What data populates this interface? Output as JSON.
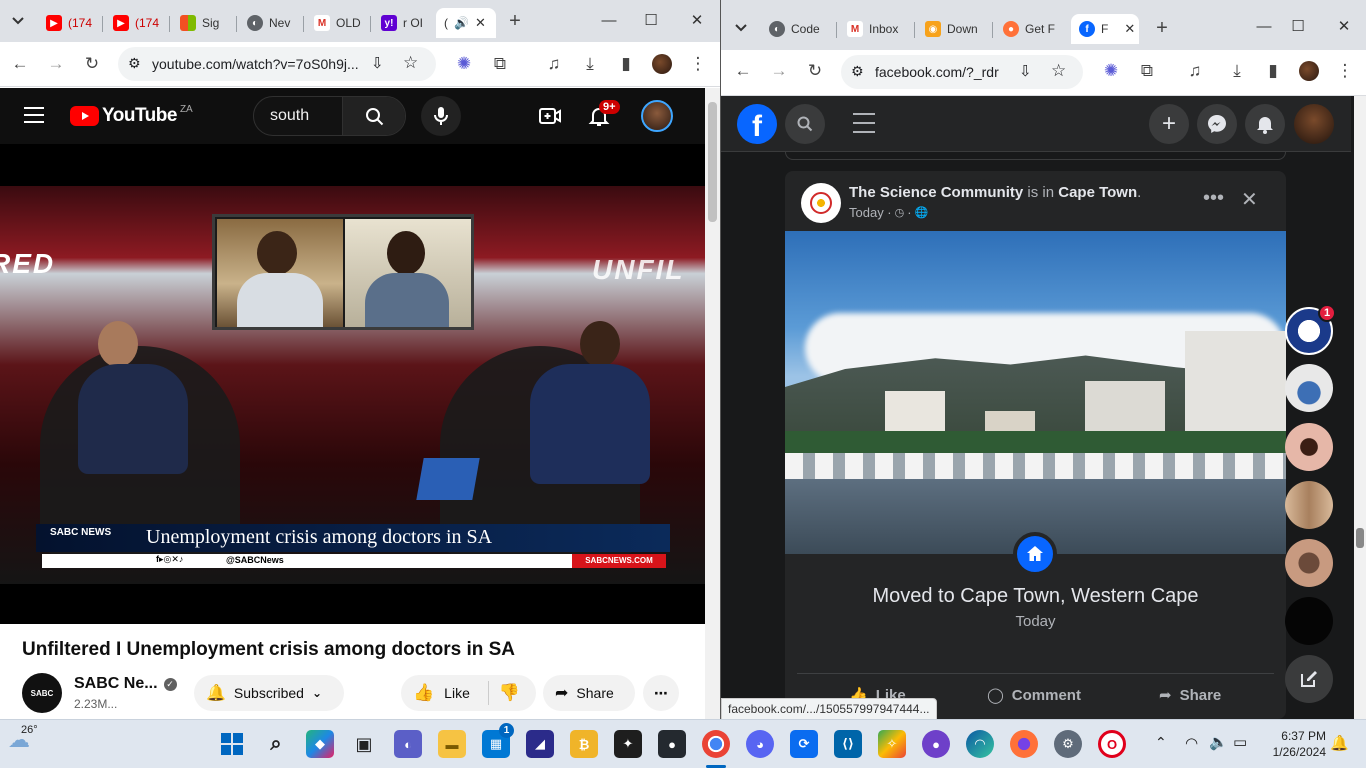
{
  "left_window": {
    "tabs": [
      {
        "label": "(174"
      },
      {
        "label": "(174"
      },
      {
        "label": "Sig"
      },
      {
        "label": "Nev"
      },
      {
        "label": "OLD"
      },
      {
        "label": "r OI"
      },
      {
        "label": "("
      }
    ],
    "url": "youtube.com/watch?v=7oS0h9j...",
    "youtube": {
      "logo_text": "YouTube",
      "region": "ZA",
      "search_value": "south",
      "notification_count": "9+",
      "video_title": "Unfiltered I Unemployment crisis among doctors in SA",
      "channel_name": "SABC Ne...",
      "subscriber_count": "2.23M...",
      "subscribed_label": "Subscribed",
      "like_label": "Like",
      "share_label": "Share",
      "lower_third": {
        "brand": "SABC NEWS",
        "headline": "Unemployment crisis among doctors in SA",
        "handle": "@SABCNews",
        "site": "SABCNEWS.COM",
        "wall_left": "RED",
        "wall_right": "UNFIL"
      }
    }
  },
  "right_window": {
    "tabs": [
      {
        "label": "Code"
      },
      {
        "label": "Inbox"
      },
      {
        "label": "Down"
      },
      {
        "label": "Get F"
      },
      {
        "label": "F"
      }
    ],
    "url": "facebook.com/?_rdr",
    "post": {
      "page_name": "The Science Community",
      "connector": " is in ",
      "location": "Cape Town",
      "period": ".",
      "time": "Today ·",
      "life_event": "Moved to Cape Town, Western Cape",
      "life_event_date": "Today",
      "like_label": "Like",
      "comment_label": "Comment",
      "share_label": "Share"
    },
    "contact_badge": "1",
    "status_url": "facebook.com/.../150557997947444..."
  },
  "taskbar": {
    "weather_temp": "26°",
    "mail_badge": "1",
    "time": "6:37 PM",
    "date": "1/26/2024"
  },
  "colors": {
    "youtube_red": "#ff0000",
    "facebook_blue": "#0866ff",
    "chrome_tabstrip": "#dee1e6"
  }
}
